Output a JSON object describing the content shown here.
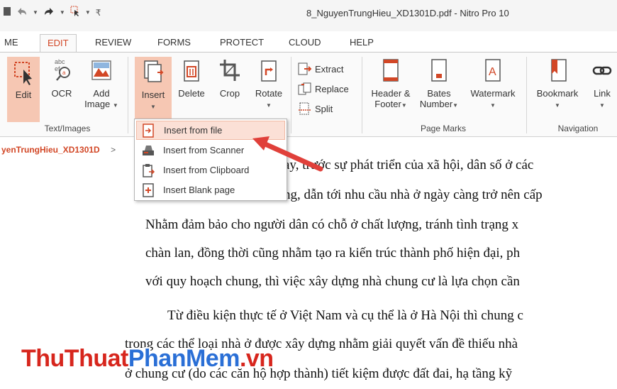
{
  "window": {
    "title": "8_NguyenTrungHieu_XD1301D.pdf - Nitro Pro 10"
  },
  "tabs": [
    "ME",
    "EDIT",
    "REVIEW",
    "FORMS",
    "PROTECT",
    "CLOUD",
    "HELP"
  ],
  "ribbon": {
    "edit": "Edit",
    "ocr": "OCR",
    "add_image_1": "Add",
    "add_image_2": "Image",
    "insert": "Insert",
    "delete": "Delete",
    "crop": "Crop",
    "rotate": "Rotate",
    "extract": "Extract",
    "replace": "Replace",
    "split": "Split",
    "header_footer_1": "Header &",
    "header_footer_2": "Footer",
    "bates_1": "Bates",
    "bates_2": "Number",
    "watermark": "Watermark",
    "bookmark": "Bookmark",
    "link": "Link",
    "ocr_icon_text_1": "abc",
    "ocr_icon_text_2": "ef",
    "groups": {
      "text_images": "Text/Images",
      "page_marks": "Page Marks",
      "navigation": "Navigation"
    }
  },
  "doc_tab": {
    "label": "yenTrungHieu_XD1301D",
    "chevron": ">"
  },
  "insert_menu": [
    {
      "label": "Insert from file",
      "icon": "insert-file-icon"
    },
    {
      "label": "Insert from Scanner",
      "icon": "scanner-icon"
    },
    {
      "label": "Insert from Clipboard",
      "icon": "clipboard-icon"
    },
    {
      "label": "Insert Blank page",
      "icon": "blank-page-icon"
    }
  ],
  "document": {
    "lines": [
      "ay,  trước sự phát triển của xã hội, dân số ở các",
      "ng, dẫn tới nhu cầu nhà ở ngày càng trở nên cấp",
      "Nhằm đảm bảo cho người dân có chỗ ở chất lượng, tránh tình trạng x",
      "chàn lan, đồng thời cũng nhằm tạo ra kiến trúc thành phố hiện đại, ph",
      "với quy hoạch chung, thì việc xây dựng nhà chung cư là lựa chọn cần",
      "Từ điều kiện thực tế ở Việt Nam và cụ thể là ở Hà Nội thì chung c",
      "trong các thể loại nhà ở được xây dựng nhằm giải quyết vấn đề thiếu nhà",
      "ở chung cư (do các căn hộ hợp thành) tiết kiệm được đất đai, hạ tầng kỹ"
    ]
  },
  "watermark": {
    "part1": "ThuThuat",
    "part2": "PhanMem",
    "part3": ".vn"
  },
  "colors": {
    "accent": "#d24726",
    "highlight": "#fbe0d6",
    "arrow": "#e0403a"
  }
}
